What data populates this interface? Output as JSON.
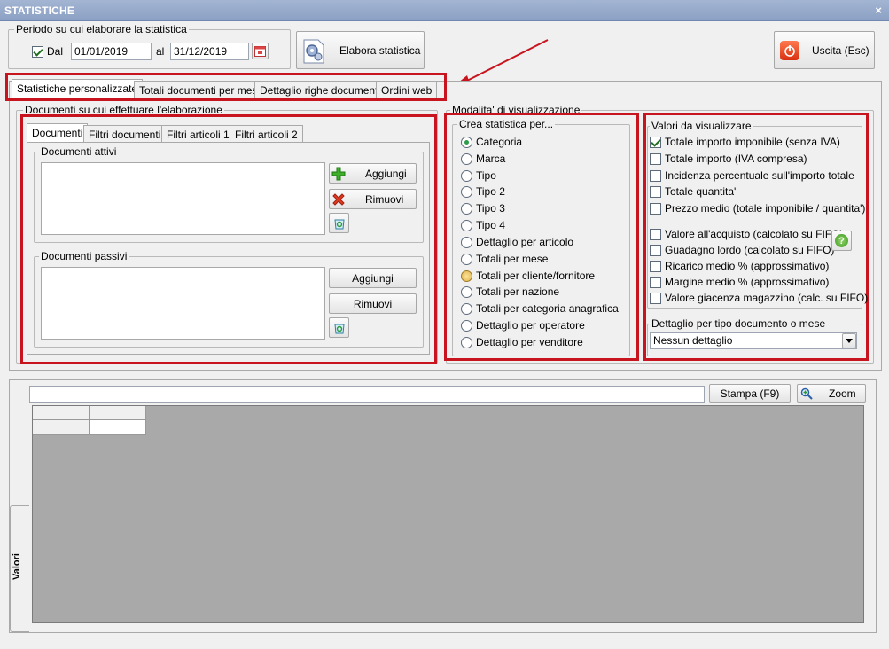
{
  "window": {
    "title": "STATISTICHE",
    "close": "×"
  },
  "period": {
    "legend": "Periodo su cui elaborare la statistica",
    "dal_label": "Dal",
    "dal_checked": true,
    "from": "01/01/2019",
    "al_label": "al",
    "to": "31/12/2019"
  },
  "toolbar": {
    "process_label": "Elabora statistica",
    "exit_label": "Uscita (Esc)"
  },
  "main_tabs": [
    {
      "label": "Statistiche personalizzate"
    },
    {
      "label": "Totali documenti per mese"
    },
    {
      "label": "Dettaglio righe documenti"
    },
    {
      "label": "Ordini web"
    }
  ],
  "docs": {
    "legend": "Documenti su cui effettuare l'elaborazione",
    "tabs": [
      {
        "label": "Documenti"
      },
      {
        "label": "Filtri documenti"
      },
      {
        "label": "Filtri articoli 1"
      },
      {
        "label": "Filtri articoli 2"
      }
    ],
    "active": {
      "legend": "Documenti attivi",
      "add": "Aggiungi",
      "remove": "Rimuovi"
    },
    "passive": {
      "legend": "Documenti passivi",
      "add": "Aggiungi",
      "remove": "Rimuovi"
    }
  },
  "modalita": {
    "legend": "Modalita' di visualizzazione"
  },
  "crea": {
    "legend": "Crea statistica per...",
    "options": [
      {
        "label": "Categoria",
        "selected": true
      },
      {
        "label": "Marca"
      },
      {
        "label": "Tipo"
      },
      {
        "label": "Tipo 2"
      },
      {
        "label": "Tipo 3"
      },
      {
        "label": "Tipo 4"
      },
      {
        "label": "Dettaglio per articolo"
      },
      {
        "label": "Totali per mese"
      },
      {
        "label": "Totali per cliente/fornitore",
        "hover": true
      },
      {
        "label": "Totali per nazione"
      },
      {
        "label": "Totali per categoria anagrafica"
      },
      {
        "label": "Dettaglio per operatore"
      },
      {
        "label": "Dettaglio per venditore"
      }
    ]
  },
  "valori": {
    "legend": "Valori da visualizzare",
    "group1": [
      {
        "label": "Totale importo imponibile (senza IVA)",
        "checked": true
      },
      {
        "label": "Totale importo (IVA compresa)"
      },
      {
        "label": "Incidenza percentuale sull'importo totale"
      },
      {
        "label": "Totale quantita'"
      },
      {
        "label": "Prezzo medio (totale imponibile / quantita')"
      }
    ],
    "group2": [
      {
        "label": "Valore all'acquisto (calcolato su FIFO)"
      },
      {
        "label": "Guadagno lordo (calcolato su FIFO)"
      },
      {
        "label": "Ricarico medio % (approssimativo)"
      },
      {
        "label": "Margine medio % (approssimativo)"
      },
      {
        "label": "Valore giacenza magazzino (calc. su FIFO)"
      }
    ]
  },
  "dettaglio": {
    "legend": "Dettaglio per tipo documento o mese",
    "value": "Nessun dettaglio"
  },
  "report": {
    "print_label": "Stampa (F9)",
    "zoom_label": "Zoom",
    "side_tab": "Valori",
    "search_value": ""
  },
  "colors": {
    "accent_red": "#c8141e",
    "title_bar": "#9aaecd",
    "grid_bg": "#a9a9a9"
  }
}
